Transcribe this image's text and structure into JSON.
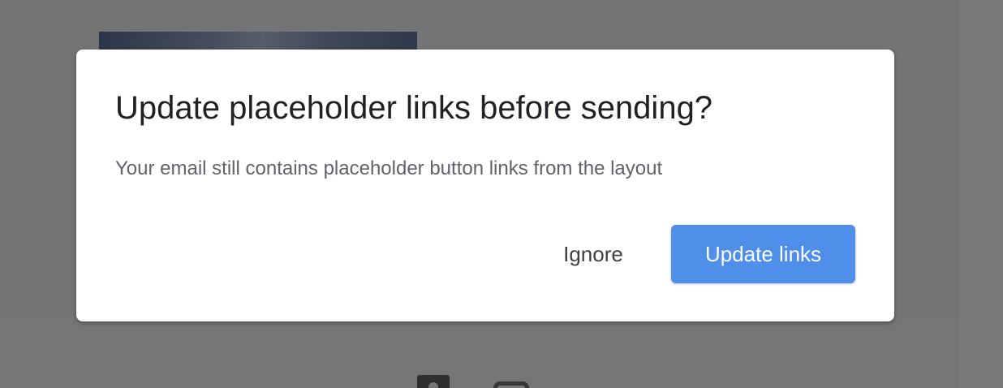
{
  "dialog": {
    "title": "Update placeholder links before sending?",
    "message": "Your email still contains placeholder button links from the layout",
    "ignore_label": "Ignore",
    "update_label": "Update links"
  },
  "background": {
    "icons": [
      "image-icon",
      "link-icon"
    ]
  },
  "colors": {
    "primary_button": "#4f8fea",
    "scrim": "rgba(32, 33, 36, 0.6)",
    "title_text": "#202124",
    "body_text": "#5f6368"
  }
}
